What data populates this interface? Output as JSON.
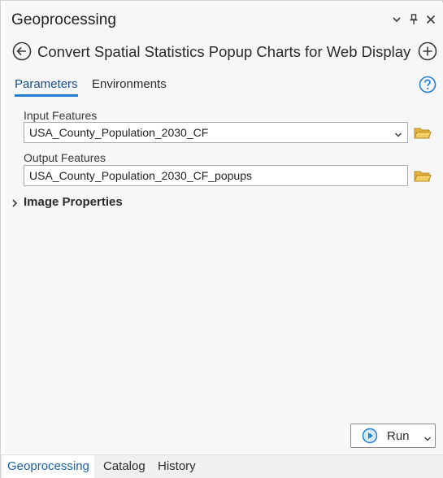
{
  "pane": {
    "title": "Geoprocessing",
    "controls": {
      "menu_icon": "chevron-down-icon",
      "pin_icon": "pin-icon",
      "close_icon": "close-icon"
    }
  },
  "tool": {
    "title": "Convert Spatial Statistics Popup Charts for Web Display",
    "back_icon": "back-arrow-icon",
    "add_icon": "add-icon"
  },
  "tabs": [
    {
      "label": "Parameters",
      "active": true
    },
    {
      "label": "Environments",
      "active": false
    }
  ],
  "help_icon": "help-icon",
  "parameters": {
    "input": {
      "label": "Input Features",
      "value": "USA_County_Population_2030_CF"
    },
    "output": {
      "label": "Output Features",
      "value": "USA_County_Population_2030_CF_popups"
    },
    "group": {
      "label": "Image Properties",
      "expanded": false
    }
  },
  "run_button": {
    "label": "Run"
  },
  "bottom_tabs": [
    {
      "label": "Geoprocessing",
      "active": true
    },
    {
      "label": "Catalog",
      "active": false
    },
    {
      "label": "History",
      "active": false
    }
  ],
  "colors": {
    "accent": "#1f7fd1",
    "folder": "#e3b341",
    "active_tab_text": "#1a5ea8"
  }
}
